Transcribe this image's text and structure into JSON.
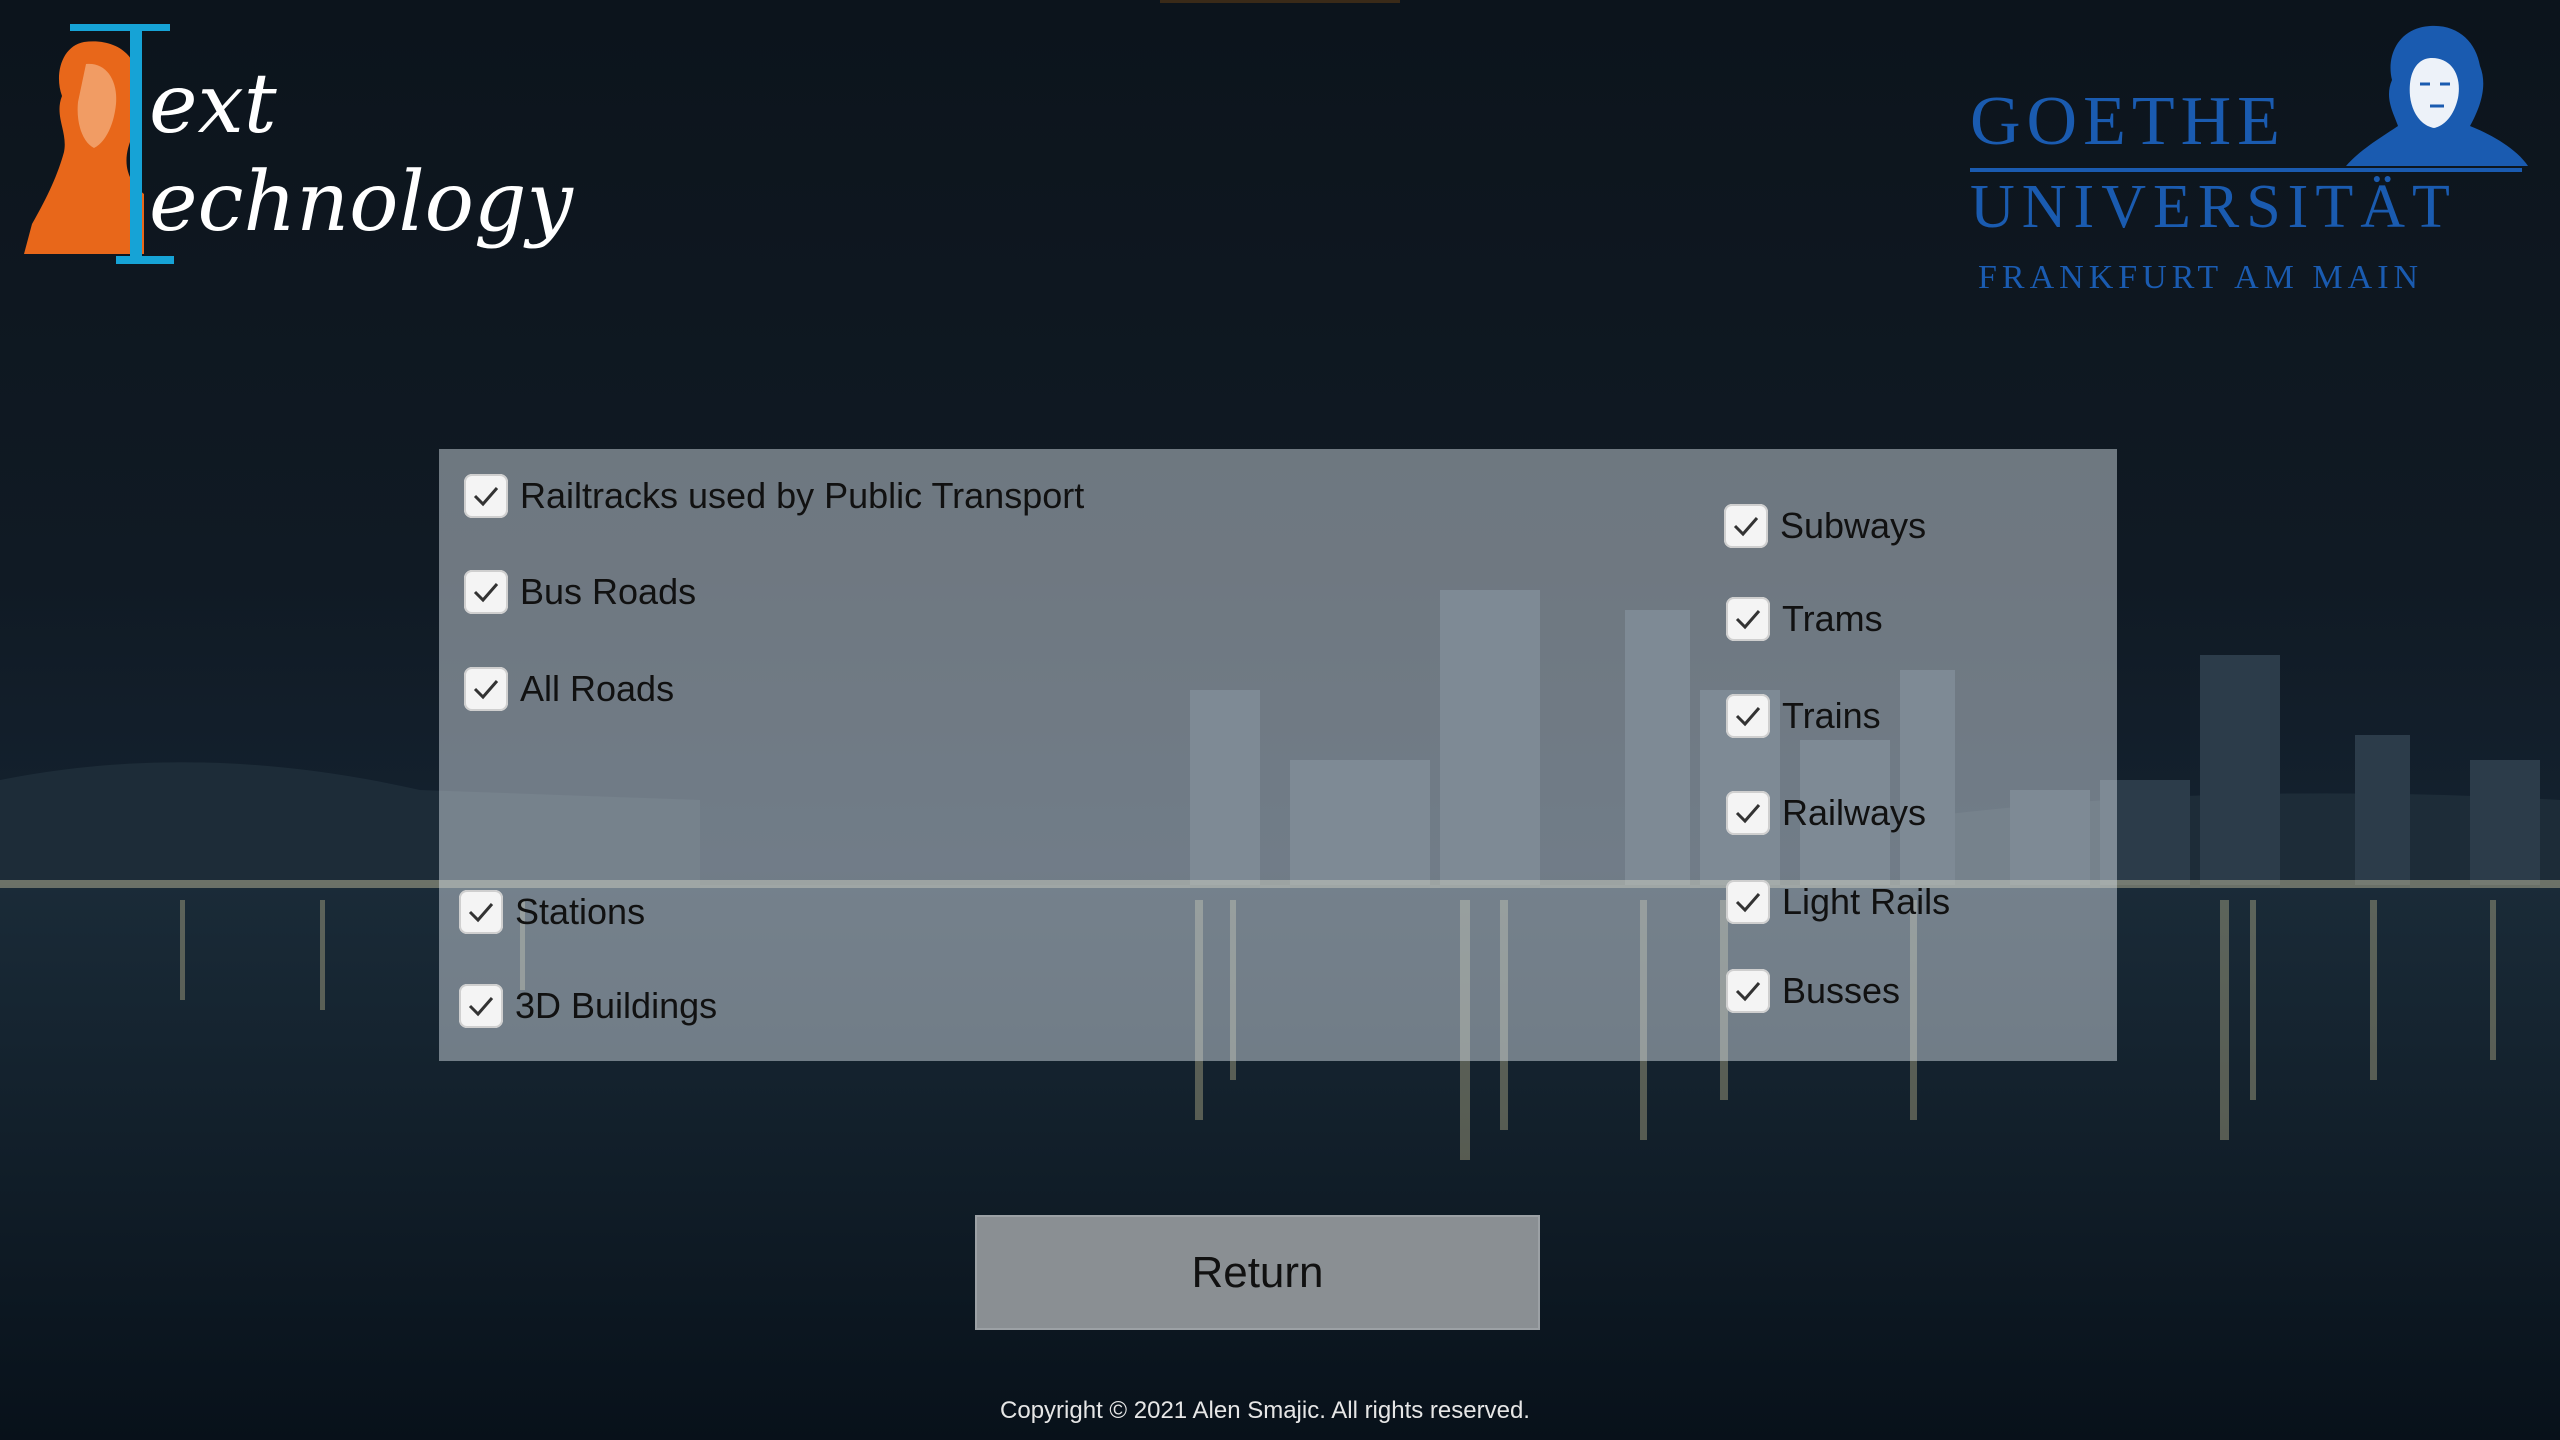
{
  "logos": {
    "text_technology": {
      "line1": "ext",
      "line2": "echnology",
      "accent_color": "#e8671a",
      "bar_color": "#16a3d6"
    },
    "goethe": {
      "line1": "GOETHE",
      "line2": "UNIVERSITÄT",
      "line3": "FRANKFURT AM MAIN",
      "color": "#1a5bb0"
    }
  },
  "options": {
    "left": [
      {
        "label": "Railtracks used by Public Transport",
        "checked": true
      },
      {
        "label": "Bus Roads",
        "checked": true
      },
      {
        "label": "All Roads",
        "checked": true
      },
      {
        "label": "Stations",
        "checked": true
      },
      {
        "label": "3D Buildings",
        "checked": true
      }
    ],
    "right": [
      {
        "label": "Subways",
        "checked": true
      },
      {
        "label": "Trams",
        "checked": true
      },
      {
        "label": "Trains",
        "checked": true
      },
      {
        "label": "Railways",
        "checked": true
      },
      {
        "label": "Light Rails",
        "checked": true
      },
      {
        "label": "Busses",
        "checked": true
      }
    ]
  },
  "return_button": {
    "label": "Return"
  },
  "footer": {
    "copyright": "Copyright © 2021 Alen Smajic. All rights reserved."
  }
}
